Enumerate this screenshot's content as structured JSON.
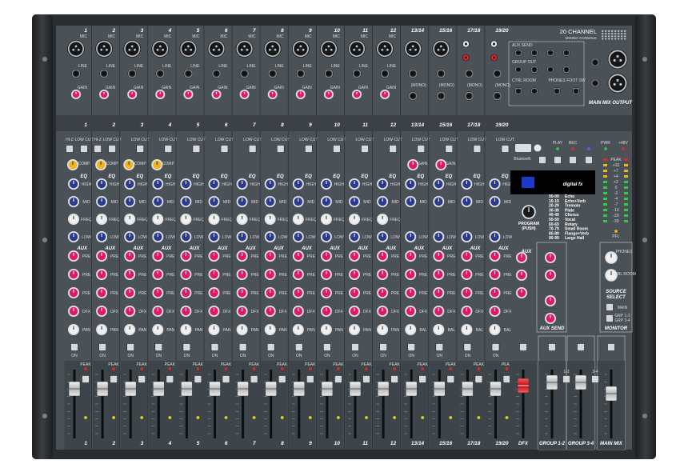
{
  "brand": {
    "title": "20 CHANNEL",
    "subtitle": "MIXING CONSOLE"
  },
  "channels": [
    {
      "label": "1",
      "stereo": false,
      "hiz": true,
      "comp": true
    },
    {
      "label": "2",
      "stereo": false,
      "hiz": true,
      "comp": true
    },
    {
      "label": "3",
      "stereo": false,
      "hiz": false,
      "comp": true
    },
    {
      "label": "4",
      "stereo": false,
      "hiz": false,
      "comp": true
    },
    {
      "label": "5",
      "stereo": false,
      "hiz": false,
      "comp": false
    },
    {
      "label": "6",
      "stereo": false,
      "hiz": false,
      "comp": false
    },
    {
      "label": "7",
      "stereo": false,
      "hiz": false,
      "comp": false
    },
    {
      "label": "8",
      "stereo": false,
      "hiz": false,
      "comp": false
    },
    {
      "label": "9",
      "stereo": false,
      "hiz": false,
      "comp": false
    },
    {
      "label": "10",
      "stereo": false,
      "hiz": false,
      "comp": false
    },
    {
      "label": "11",
      "stereo": false,
      "hiz": false,
      "comp": false
    },
    {
      "label": "12",
      "stereo": false,
      "hiz": false,
      "comp": false
    },
    {
      "label": "13/14",
      "stereo": true,
      "hiz": false,
      "comp": false
    },
    {
      "label": "15/16",
      "stereo": true,
      "hiz": false,
      "comp": false
    },
    {
      "label": "17/18",
      "stereo": true,
      "hiz": false,
      "comp": false
    },
    {
      "label": "19/20",
      "stereo": true,
      "hiz": false,
      "comp": false
    }
  ],
  "labels": {
    "mic": "MIC",
    "line": "LINE",
    "gain": "GAIN",
    "mono": "(MONO)",
    "hiz": "HI-Z",
    "low_cut": "LOW CUT",
    "comp": "COMP",
    "eq": "EQ",
    "high": "HIGH",
    "mid": "MID",
    "freq": "FREQ",
    "low": "LOW",
    "aux": "AUX",
    "pre": "PRE",
    "dfx": "DFX",
    "pan": "PAN",
    "bal": "BAL",
    "on": "ON",
    "peak": "PEAK",
    "pwr": "PWR",
    "v48": "+48V",
    "pfl": "PFL"
  },
  "top_right": {
    "aux_send": "AUX SEND",
    "group_out": "GROUP OUT",
    "ctrl_room": "CTRL ROOM",
    "phones": "PHONES",
    "foot_sw": "FOOT SW",
    "main_mix_output": "MAIN MIX OUTPUT"
  },
  "media": {
    "bluetooth": "Bluetooth",
    "play": "PLAY",
    "rec": "REC"
  },
  "dfx": {
    "logo": "digital fx",
    "program": "PROGRAM",
    "push": "(PUSH)",
    "presets": [
      {
        "range": "00-09",
        "name": "Echo"
      },
      {
        "range": "10-19",
        "name": "Echo+Verb"
      },
      {
        "range": "20-29",
        "name": "Tremolo"
      },
      {
        "range": "30-39",
        "name": "Plate"
      },
      {
        "range": "40-49",
        "name": "Chorus"
      },
      {
        "range": "50-59",
        "name": "Vocal"
      },
      {
        "range": "60-69",
        "name": "Rotary"
      },
      {
        "range": "70-79",
        "name": "Small Room"
      },
      {
        "range": "80-89",
        "name": "Flange+Verb"
      },
      {
        "range": "90-99",
        "name": "Large Hall"
      }
    ]
  },
  "meter": {
    "levels": [
      "PEAK",
      "+10",
      "+7",
      "+4",
      "+2",
      "0",
      "-2",
      "-4",
      "-7",
      "-10",
      "-20",
      "-30"
    ],
    "left_lit": 0.0,
    "right_lit": 0.0
  },
  "monitor": {
    "phones": "PHONES",
    "ctrl_room": "CTRL ROOM",
    "source": "SOURCE",
    "select": "SELECT",
    "main": "MAIN",
    "grp12": "GRP 1-2",
    "grp34": "GRP 3-4",
    "title": "MONITOR"
  },
  "aux_send_title": "AUX SEND",
  "bottom": {
    "dfx": "DFX",
    "group12": "GROUP 1-2",
    "group34": "GROUP 3-4",
    "main_mix": "MAIN MIX",
    "group12_btn": "1-2",
    "group34_btn": "3-4",
    "lr": "L-R"
  },
  "colors": {
    "chassis": "#2a2d30",
    "panel": "#4a5157",
    "knob_blue": "#2a3a8c",
    "knob_pink": "#e0186a",
    "knob_yellow": "#f2b21e",
    "knob_white": "#f0f0f0",
    "led_red": "#e3262b",
    "led_green": "#2ecc40"
  }
}
